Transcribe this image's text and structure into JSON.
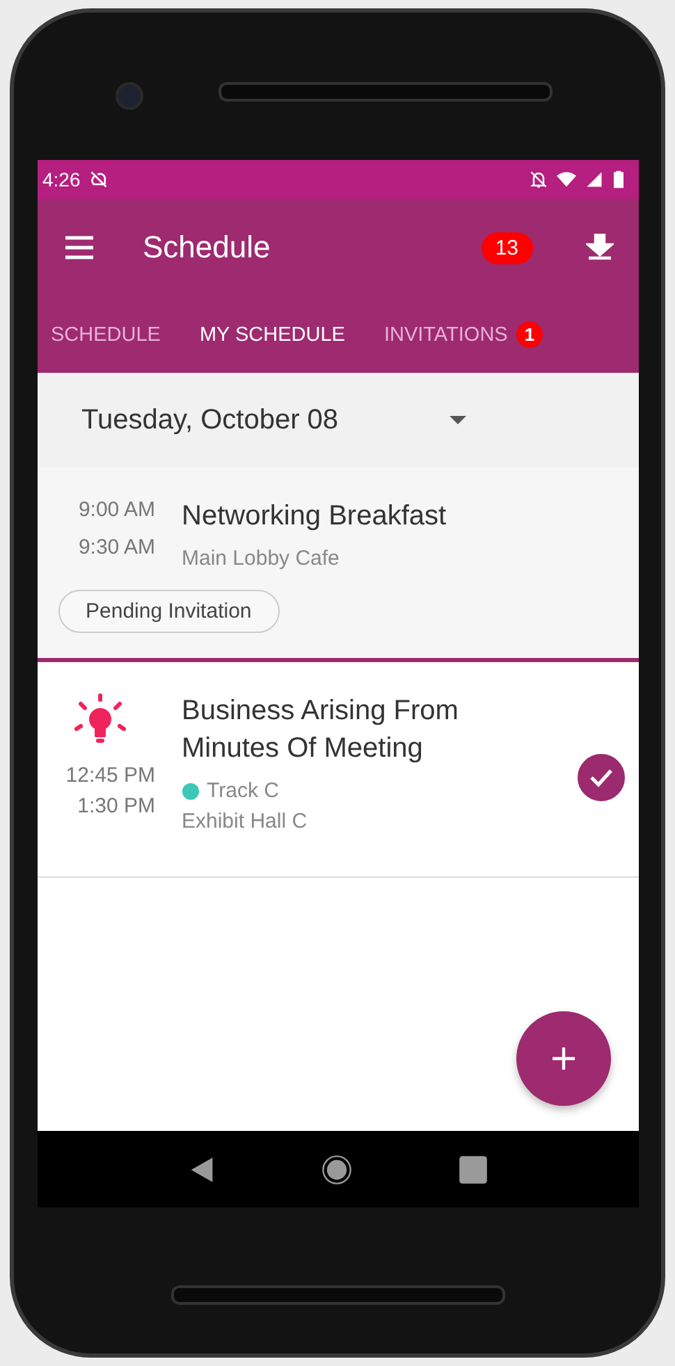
{
  "status_bar": {
    "time": "4:26"
  },
  "app_bar": {
    "title": "Schedule",
    "badge": "13"
  },
  "tabs": [
    {
      "label": "SCHEDULE",
      "selected": false
    },
    {
      "label": "MY SCHEDULE",
      "selected": true
    },
    {
      "label": "INVITATIONS",
      "selected": false,
      "badge": "1"
    }
  ],
  "date_picker": {
    "value": "Tuesday, October 08"
  },
  "events": [
    {
      "kind": "invitation",
      "start": "9:00 AM",
      "end": "9:30 AM",
      "title": "Networking Breakfast",
      "location": "Main Lobby Cafe",
      "status": "Pending Invitation",
      "checked": false
    },
    {
      "kind": "session",
      "start": "12:45 PM",
      "end": "1:30 PM",
      "title": "Business Arising From Minutes Of Meeting",
      "track": "Track C",
      "color": "#3cc8b4",
      "location": "Exhibit Hall C",
      "checked": true
    }
  ]
}
